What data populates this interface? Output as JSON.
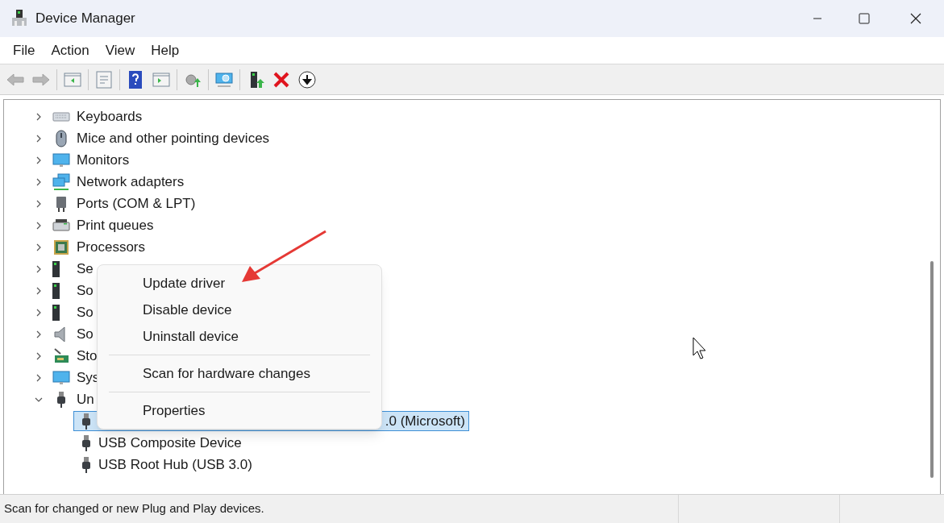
{
  "window": {
    "title": "Device Manager"
  },
  "menu_bar": [
    "File",
    "Action",
    "View",
    "Help"
  ],
  "tree": [
    {
      "label": "Keyboards",
      "expanded": false
    },
    {
      "label": "Mice and other pointing devices",
      "expanded": false
    },
    {
      "label": "Monitors",
      "expanded": false
    },
    {
      "label": "Network adapters",
      "expanded": false
    },
    {
      "label": "Ports (COM & LPT)",
      "expanded": false
    },
    {
      "label": "Print queues",
      "expanded": false
    },
    {
      "label": "Processors",
      "expanded": false
    },
    {
      "label": "Se",
      "expanded": false
    },
    {
      "label": "So",
      "expanded": false
    },
    {
      "label": "So",
      "expanded": false
    },
    {
      "label": "So",
      "expanded": false
    },
    {
      "label": "Sto",
      "expanded": false
    },
    {
      "label": "Sys",
      "expanded": false
    },
    {
      "label": "Un",
      "expanded": true,
      "children": [
        {
          "label": ".0 (Microsoft)",
          "selected": true
        },
        {
          "label": "USB Composite Device",
          "selected": false
        },
        {
          "label": "USB Root Hub (USB 3.0)",
          "selected": false
        }
      ]
    }
  ],
  "context_menu": [
    {
      "kind": "item",
      "label": "Update driver"
    },
    {
      "kind": "item",
      "label": "Disable device"
    },
    {
      "kind": "item",
      "label": "Uninstall device"
    },
    {
      "kind": "separator"
    },
    {
      "kind": "item",
      "label": "Scan for hardware changes"
    },
    {
      "kind": "separator"
    },
    {
      "kind": "item",
      "label": "Properties"
    }
  ],
  "status_bar": {
    "text": "Scan for changed or new Plug and Play devices."
  }
}
